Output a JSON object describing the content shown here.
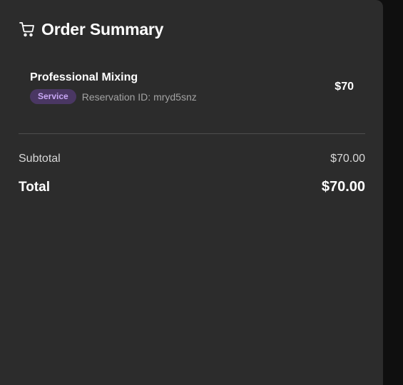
{
  "header": {
    "icon": "cart-icon",
    "title": "Order Summary"
  },
  "items": [
    {
      "name": "Professional Mixing",
      "badge": "Service",
      "reservation": "Reservation ID: mryd5snz",
      "price": "$70"
    }
  ],
  "summary": {
    "subtotal_label": "Subtotal",
    "subtotal_value": "$70.00",
    "total_label": "Total",
    "total_value": "$70.00"
  },
  "colors": {
    "background": "#0f0f0f",
    "panel": "#2c2c2c",
    "badge_bg": "#4a3763",
    "badge_text": "#c9a8f5",
    "muted_text": "#a3a3a3"
  }
}
